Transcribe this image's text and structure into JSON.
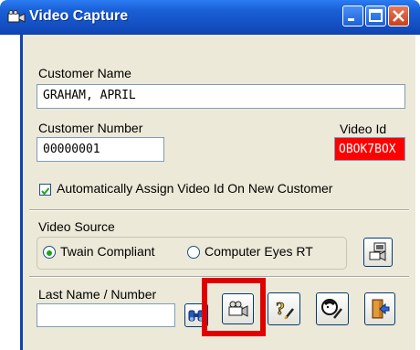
{
  "window": {
    "title": "Video Capture"
  },
  "customer_name": {
    "label": "Customer Name",
    "value": "GRAHAM, APRIL"
  },
  "customer_number": {
    "label": "Customer Number",
    "value": "00000001"
  },
  "video_id": {
    "label": "Video Id",
    "value": "OBOK7BOX",
    "bg_color": "#ff0000"
  },
  "auto_assign": {
    "label": "Automatically Assign Video Id On New Customer",
    "checked": true
  },
  "video_source": {
    "label": "Video Source",
    "options": [
      {
        "label": "Twain Compliant",
        "selected": true
      },
      {
        "label": "Computer Eyes RT",
        "selected": false
      }
    ]
  },
  "search": {
    "label": "Last Name / Number",
    "value": ""
  },
  "toolbar_icons": [
    "binoculars-icon",
    "camera-icon",
    "help-icon",
    "user-help-icon",
    "exit-icon"
  ],
  "highlight_color": "#e00000"
}
